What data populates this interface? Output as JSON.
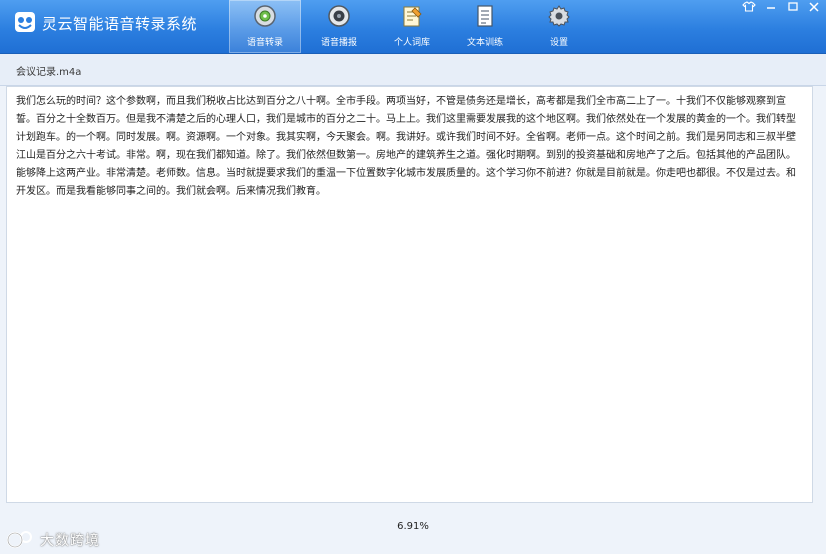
{
  "app": {
    "title": "灵云智能语音转录系统",
    "accent_color": "#2c7fe0"
  },
  "tabs": [
    {
      "label": "语音转录",
      "icon": "disc-icon",
      "active": true
    },
    {
      "label": "语音播报",
      "icon": "speaker-icon",
      "active": false
    },
    {
      "label": "个人词库",
      "icon": "notepad-icon",
      "active": false
    },
    {
      "label": "文本训练",
      "icon": "document-icon",
      "active": false
    },
    {
      "label": "设置",
      "icon": "gear-icon",
      "active": false
    }
  ],
  "window_controls": [
    "shirt-icon",
    "minimize-icon",
    "maximize-icon",
    "close-icon"
  ],
  "file": {
    "name": "会议记录.m4a"
  },
  "transcript": {
    "text": "我们怎么玩的时间？这个参数啊，而且我们税收占比达到百分之八十啊。全市手段。两项当好，不管是债务还是增长，高考都是我们全市高二上了一。十我们不仅能够观察到宣誓。百分之十全数百万。但是我不清楚之后的心理人口，我们是城市的百分之二十。马上上。我们这里需要发展我的这个地区啊。我们依然处在一个发展的黄金的一个。我们转型计划跑车。的一个啊。同时发展。啊。资源啊。一个对象。我其实啊，今天聚会。啊。我讲好。或许我们时间不好。全省啊。老师一点。这个时间之前。我们是另同志和三叔半壁江山是百分之六十考试。非常。啊，现在我们都知道。除了。我们依然但数第一。房地产的建筑养生之道。强化时期啊。到别的投资基础和房地产了之后。包括其他的产品团队。能够降上这两产业。非常清楚。老师数。信息。当时就提要求我们的重温一下位置数字化城市发展质量的。这个学习你不前进？你就是目前就是。你走吧也都很。不仅是过去。和开发区。而是我看能够同事之间的。我们就会啊。后来情况我们教育。"
  },
  "progress": {
    "text": "6.91%"
  },
  "watermark": {
    "text": "大数跨境",
    "icon": "watermark-logo-icon"
  }
}
